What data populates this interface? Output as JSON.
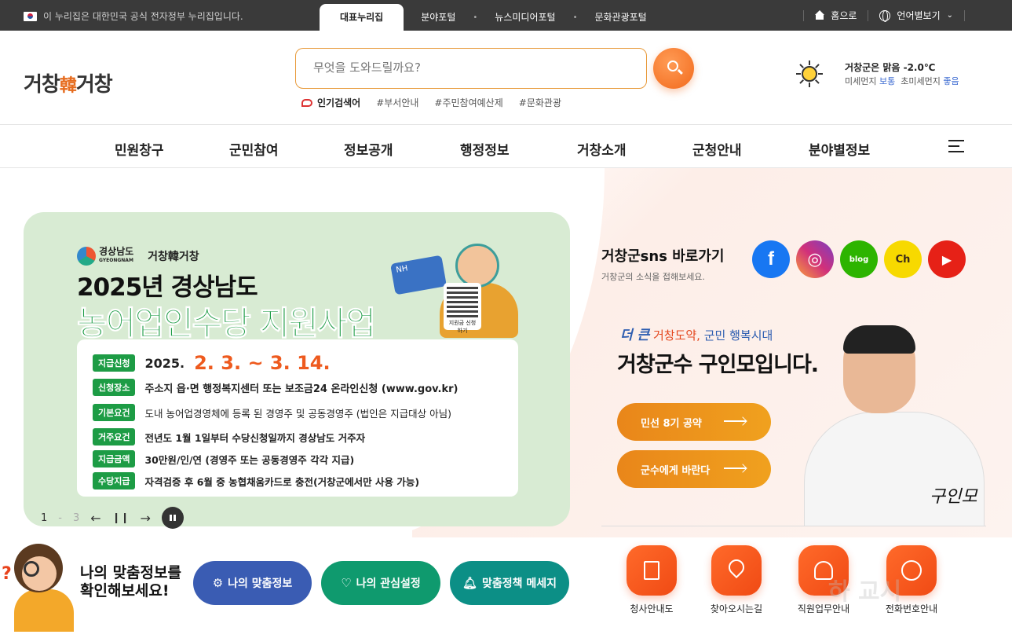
{
  "topbar": {
    "notice": "이 누리집은 대한민국 공식 전자정부 누리집입니다.",
    "portals": [
      "대표누리집",
      "분야포털",
      "뉴스미디어포털",
      "문화관광포털"
    ],
    "home_label": "홈으로",
    "language_label": "언어별보기"
  },
  "header": {
    "logo_text_left": "거창",
    "logo_text_right": "거창",
    "search_placeholder": "무엇을 도와드릴까요?",
    "popular_label": "인기검색어",
    "popular_tags": [
      "#부서안내",
      "#주민참여예산제",
      "#문화관광"
    ],
    "weather_main": "거창군은 맑음 -2.0℃",
    "weather_dust_label": "미세먼지",
    "weather_dust_value": "보통",
    "weather_fine_label": "초미세먼지",
    "weather_fine_value": "좋음"
  },
  "gnb": {
    "items": [
      "민원창구",
      "군민참여",
      "정보공개",
      "행정정보",
      "거창소개",
      "군청안내",
      "분야별정보"
    ]
  },
  "banner": {
    "logo_gn": "경상남도",
    "logo_gn_sub": "GYEONGNAM",
    "logo_gc": "거창韓거창",
    "title1": "2025년 경상남도",
    "title2": "농어업인수당 지원사업",
    "card_label": "NH",
    "qr_label": "지원금 신청하기",
    "rows": [
      {
        "tag": "지급신청",
        "text_pre": "2025.",
        "text_hi": "2. 3. ~ 3. 14.",
        "text": ""
      },
      {
        "tag": "신청장소",
        "text": "주소지 읍·면 행정복지센터 또는 보조금24 온라인신청 (www.gov.kr)"
      },
      {
        "tag": "기본요건",
        "text": "도내 농어업경영체에 등록 된 경영주 및 공동경영주 (법인은 지급대상 아님)"
      },
      {
        "tag": "거주요건",
        "text": "전년도 1월 1일부터 수당신청일까지 경상남도 거주자"
      },
      {
        "tag": "지급금액",
        "text": "30만원/인/연 (경영주 또는 공동경영주 각각 지급)"
      },
      {
        "tag": "수당지급",
        "text": "자격검증 후 6월 중 농협채움카드로 충전(거창군에서만 사용 가능)"
      }
    ],
    "pager_current": "1",
    "pager_total": "3"
  },
  "sns": {
    "title": "거창군sns 바로가기",
    "subtitle": "거창군의 소식을 접해보세요.",
    "icons": [
      {
        "name": "facebook-icon",
        "glyph": "f",
        "color": "#1877f2"
      },
      {
        "name": "instagram-icon",
        "glyph": "◎",
        "color": "#d1307a"
      },
      {
        "name": "blog-icon",
        "glyph": "blog",
        "color": "#2db400"
      },
      {
        "name": "kakao-channel-icon",
        "glyph": "Ch",
        "color": "#f7d900"
      },
      {
        "name": "youtube-icon",
        "glyph": "▶",
        "color": "#e62117"
      }
    ]
  },
  "mayor": {
    "slogan_a": "더 큰",
    "slogan_b": "거창도약,",
    "slogan_c": "군민 행복시대",
    "title": "거창군수 구인모입니다.",
    "btn1": "민선 8기 공약",
    "btn2": "군수에게 바란다",
    "signature": "구인모"
  },
  "custom": {
    "title_line1": "나의 맞춤정보를",
    "title_line2": "확인해보세요!",
    "btn1": "나의 맞춤정보",
    "btn2": "나의 관심설정",
    "btn3": "맞춤정책 메세지"
  },
  "quick": [
    "청사안내도",
    "찾아오시는길",
    "직원업무안내",
    "전화번호안내"
  ],
  "watermark": "하 교시"
}
